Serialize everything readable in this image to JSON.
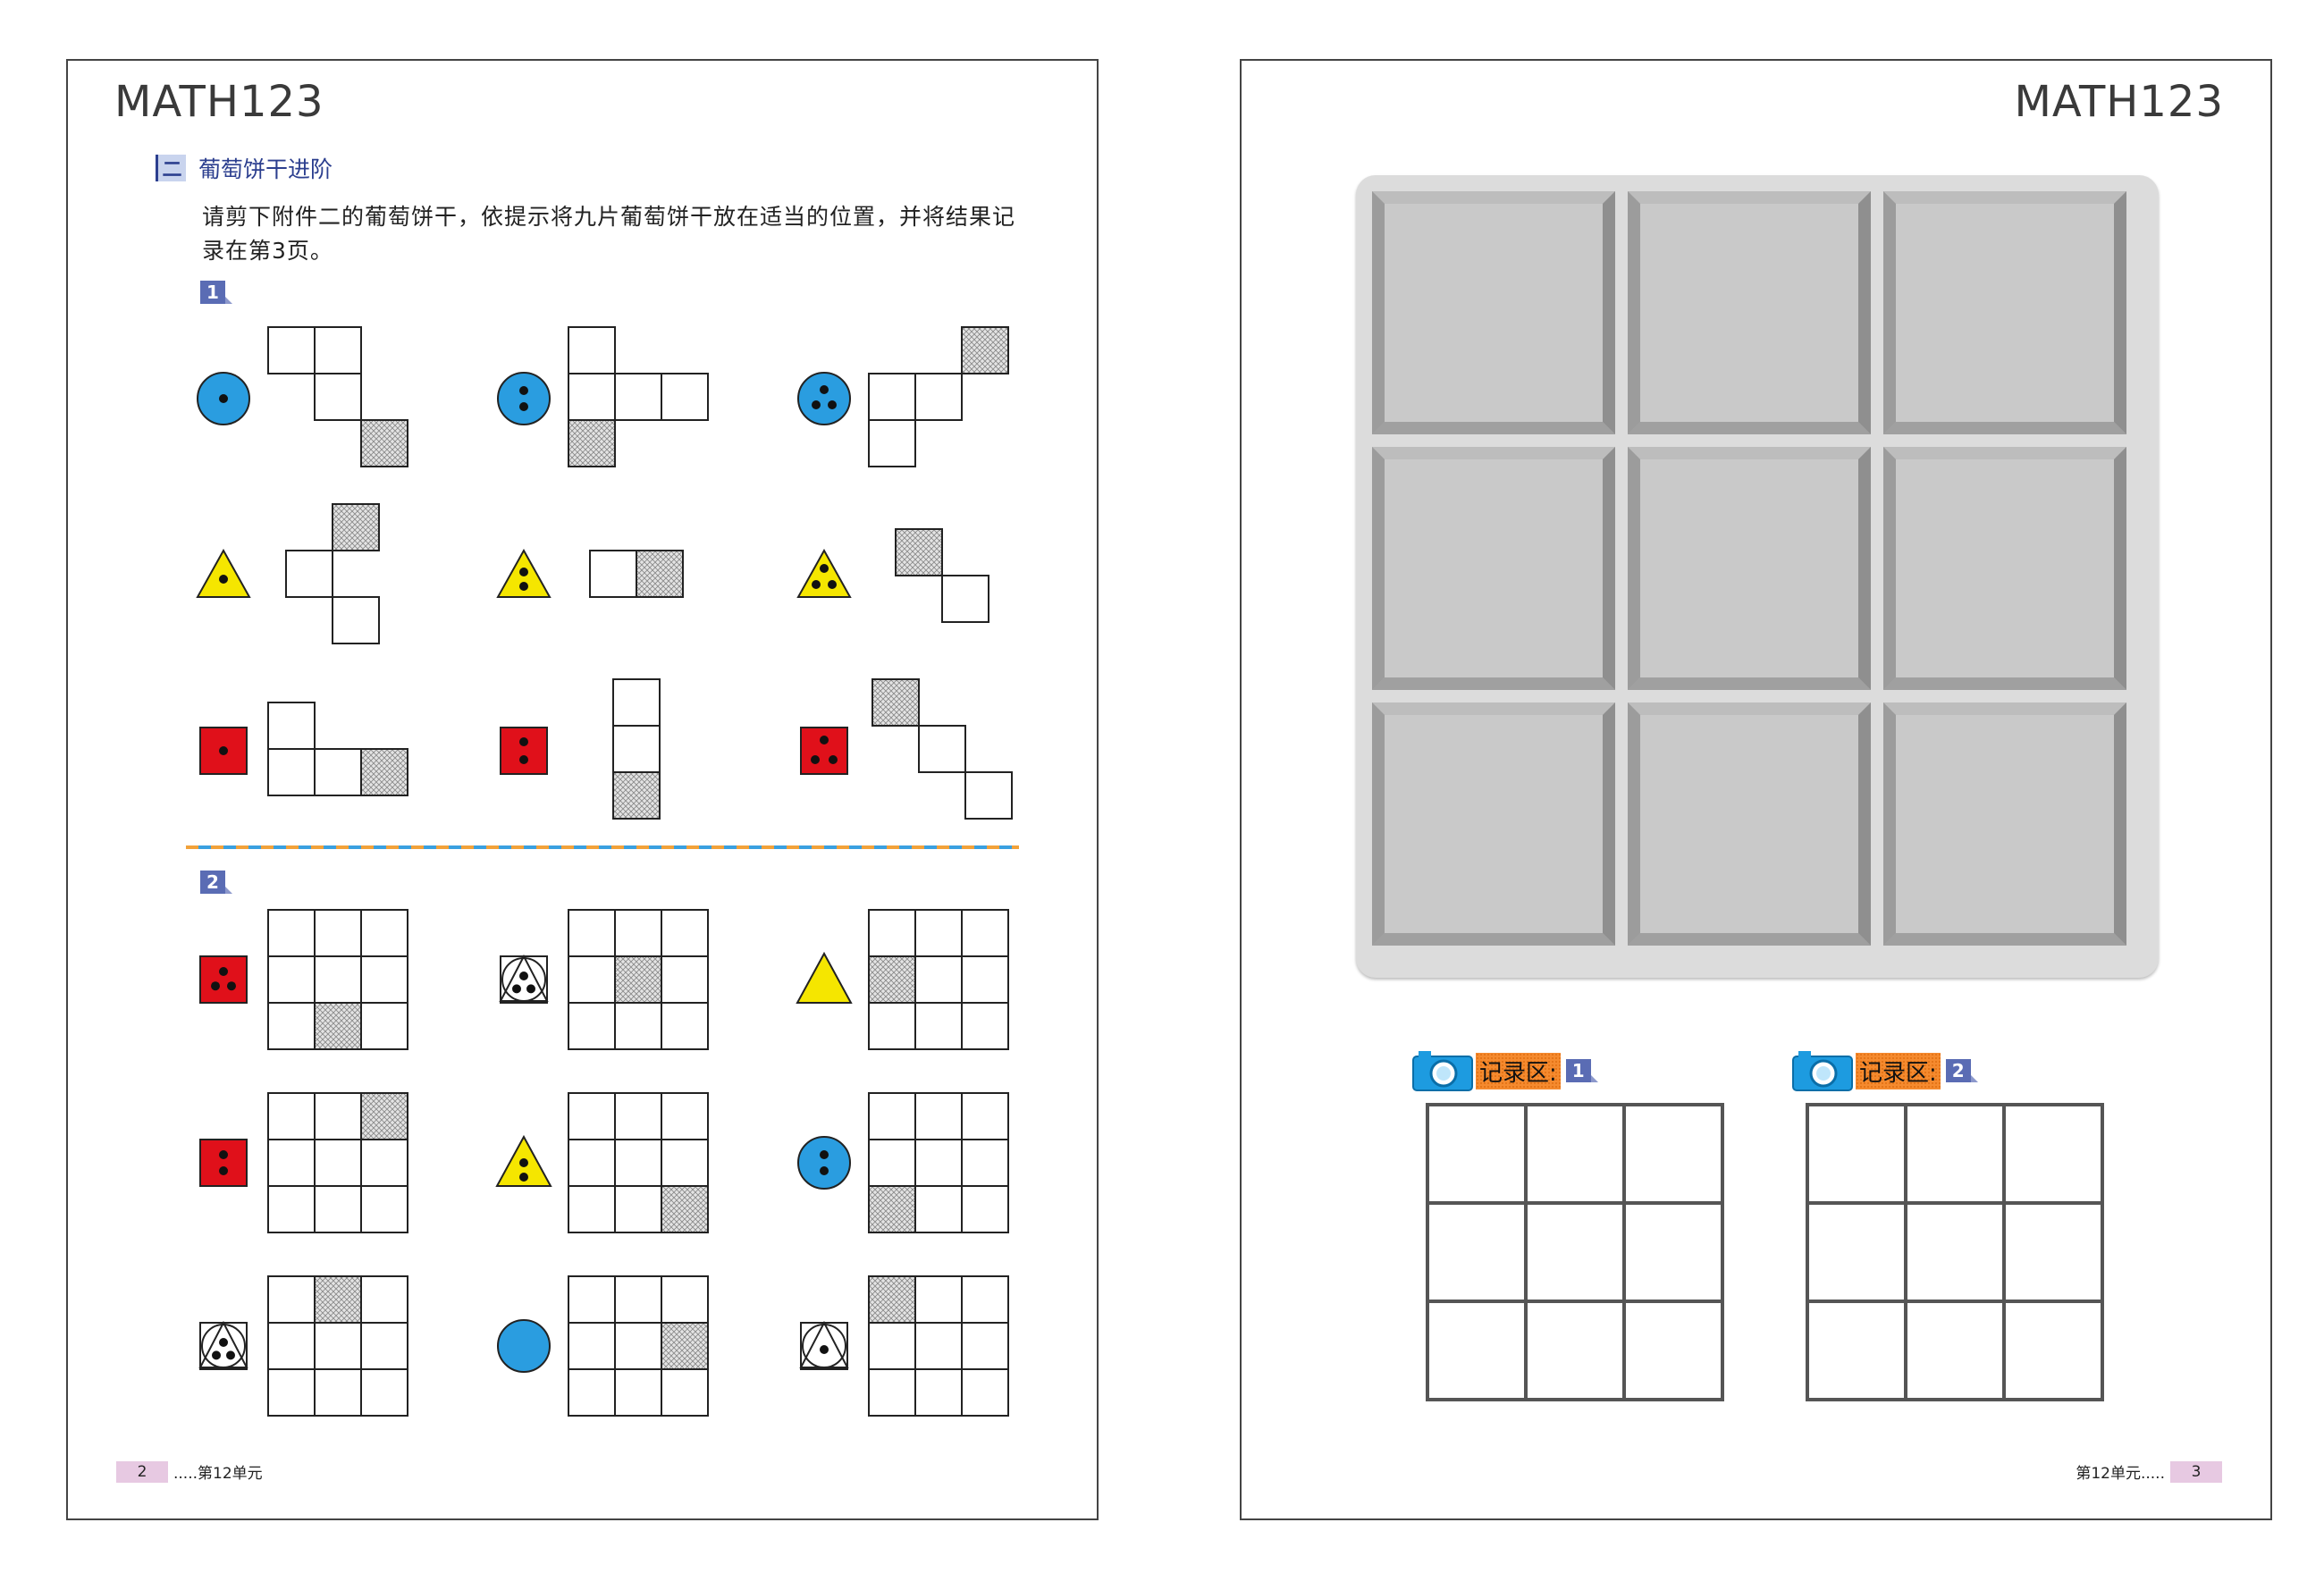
{
  "left_page": {
    "logo": "MATH123",
    "section_number": "二",
    "section_title": "葡萄饼干进阶",
    "intro": "请剪下附件二的葡萄饼干，依提示将九片葡萄饼干放在适当的位置，并将结果记录在第3页。",
    "part1_label": "1",
    "part2_label": "2",
    "footer_page": "2",
    "footer_unit": ".....第12单元"
  },
  "right_page": {
    "logo": "MATH123",
    "record1_label": "记录区:",
    "record1_num": "1",
    "record2_label": "记录区:",
    "record2_num": "2",
    "footer_unit": "第12单元.....",
    "footer_page": "3"
  },
  "colors": {
    "circle": "#2a9de0",
    "triangle": "#f5e600",
    "square": "#e0101a",
    "hatch": "#888888",
    "tray": "#c9c9c9",
    "title_blue": "#2c3f8f"
  },
  "part1_clues": [
    {
      "shape": "circle",
      "dots": 1
    },
    {
      "shape": "circle",
      "dots": 2
    },
    {
      "shape": "circle",
      "dots": 3
    },
    {
      "shape": "triangle",
      "dots": 1
    },
    {
      "shape": "triangle",
      "dots": 2
    },
    {
      "shape": "triangle",
      "dots": 3
    },
    {
      "shape": "square",
      "dots": 1
    },
    {
      "shape": "square",
      "dots": 2
    },
    {
      "shape": "square",
      "dots": 3
    }
  ],
  "part2_clues": [
    {
      "shape": "square",
      "dots": 3,
      "hatched": [
        2,
        1
      ]
    },
    {
      "shape": "outline-combo",
      "dots": 3,
      "hatched": [
        1,
        1
      ]
    },
    {
      "shape": "triangle",
      "dots": 0,
      "hatched": [
        1,
        0
      ]
    },
    {
      "shape": "square",
      "dots": 2,
      "hatched": [
        0,
        2
      ]
    },
    {
      "shape": "triangle",
      "dots": 2,
      "hatched": [
        2,
        2
      ]
    },
    {
      "shape": "circle",
      "dots": 2,
      "hatched": [
        2,
        0
      ]
    },
    {
      "shape": "outline-combo",
      "dots": 3,
      "hatched": [
        0,
        1
      ]
    },
    {
      "shape": "circle",
      "dots": 0,
      "hatched": [
        1,
        2
      ]
    },
    {
      "shape": "outline-combo",
      "dots": 1,
      "hatched": [
        0,
        0
      ]
    }
  ]
}
